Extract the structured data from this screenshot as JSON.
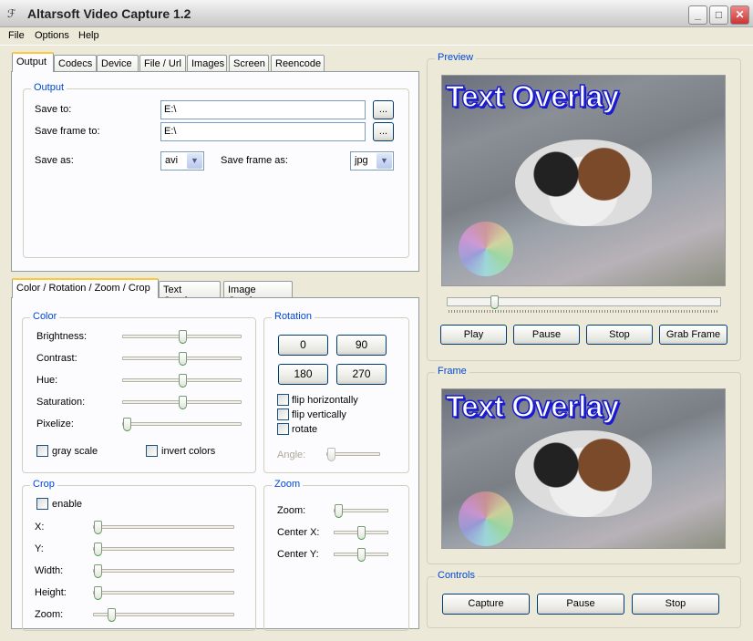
{
  "window": {
    "title": "Altarsoft Video Capture 1.2",
    "minimize": "_",
    "maximize": "□",
    "close": "✕"
  },
  "menu": [
    "File",
    "Options",
    "Help"
  ],
  "top_tabs": [
    "Output",
    "Codecs",
    "Device",
    "File / Url",
    "Images",
    "Screen",
    "Reencode"
  ],
  "output": {
    "group": "Output",
    "save_to_label": "Save to:",
    "save_to_value": "E:\\",
    "save_frame_to_label": "Save frame to:",
    "save_frame_to_value": "E:\\",
    "browse": "...",
    "save_as_label": "Save as:",
    "save_as_value": "avi",
    "save_frame_as_label": "Save frame as:",
    "save_frame_as_value": "jpg"
  },
  "bottom_tabs": [
    "Color / Rotation / Zoom / Crop",
    "Text Overlay",
    "Image Overlay"
  ],
  "color": {
    "group": "Color",
    "sliders": [
      {
        "label": "Brightness:",
        "value": 0.5
      },
      {
        "label": "Contrast:",
        "value": 0.5
      },
      {
        "label": "Hue:",
        "value": 0.5
      },
      {
        "label": "Saturation:",
        "value": 0.5
      },
      {
        "label": "Pixelize:",
        "value": 0
      }
    ],
    "gray_scale": "gray scale",
    "invert_colors": "invert colors"
  },
  "rotation": {
    "group": "Rotation",
    "buttons": [
      "0",
      "90",
      "180",
      "270"
    ],
    "flip_h": "flip horizontally",
    "flip_v": "flip vertically",
    "rotate": "rotate",
    "angle_label": "Angle:",
    "angle_value": 0
  },
  "crop": {
    "group": "Crop",
    "enable": "enable",
    "sliders": [
      {
        "label": "X:",
        "value": 0
      },
      {
        "label": "Y:",
        "value": 0
      },
      {
        "label": "Width:",
        "value": 0
      },
      {
        "label": "Height:",
        "value": 0
      },
      {
        "label": "Zoom:",
        "value": 0.1
      }
    ]
  },
  "zoom": {
    "group": "Zoom",
    "sliders": [
      {
        "label": "Zoom:",
        "value": 0
      },
      {
        "label": "Center X:",
        "value": 0.5
      },
      {
        "label": "Center Y:",
        "value": 0.5
      }
    ]
  },
  "preview": {
    "group": "Preview",
    "overlay_text": "Text Overlay",
    "seek_value": 0.16,
    "buttons": [
      "Play",
      "Pause",
      "Stop",
      "Grab Frame"
    ]
  },
  "frame": {
    "group": "Frame",
    "overlay_text": "Text Overlay"
  },
  "controls": {
    "group": "Controls",
    "buttons": [
      "Capture",
      "Pause",
      "Stop"
    ]
  }
}
